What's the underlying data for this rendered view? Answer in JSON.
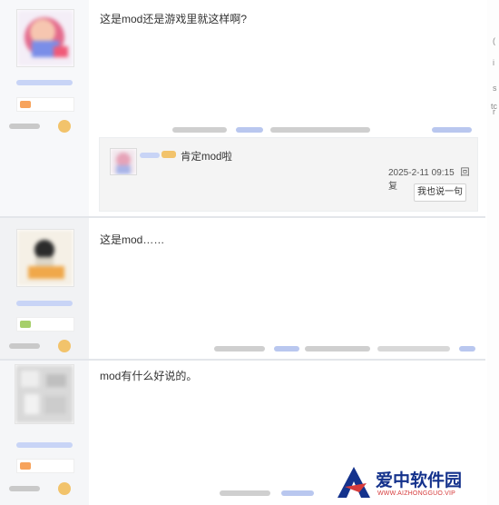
{
  "posts": [
    {
      "content": "这是mod还是游戏里就这样啊?"
    },
    {
      "content": "这是mod……"
    },
    {
      "content": "mod有什么好说的。"
    }
  ],
  "reply": {
    "text": "肯定mod啦",
    "time": "2025-2-11 09:15",
    "reply_label": "回复",
    "button_label": "我也说一句"
  },
  "side_glyphs": [
    "(",
    "i",
    "s",
    "r",
    "tc"
  ],
  "watermark": {
    "name": "爱中软件园",
    "url": "WWW.AIZHONGGUO.VIP"
  },
  "colors": {
    "username": "#c8d4f6",
    "coin": "#f2c36b",
    "watermark_blue": "#14328c",
    "watermark_red": "#d63b3b"
  }
}
